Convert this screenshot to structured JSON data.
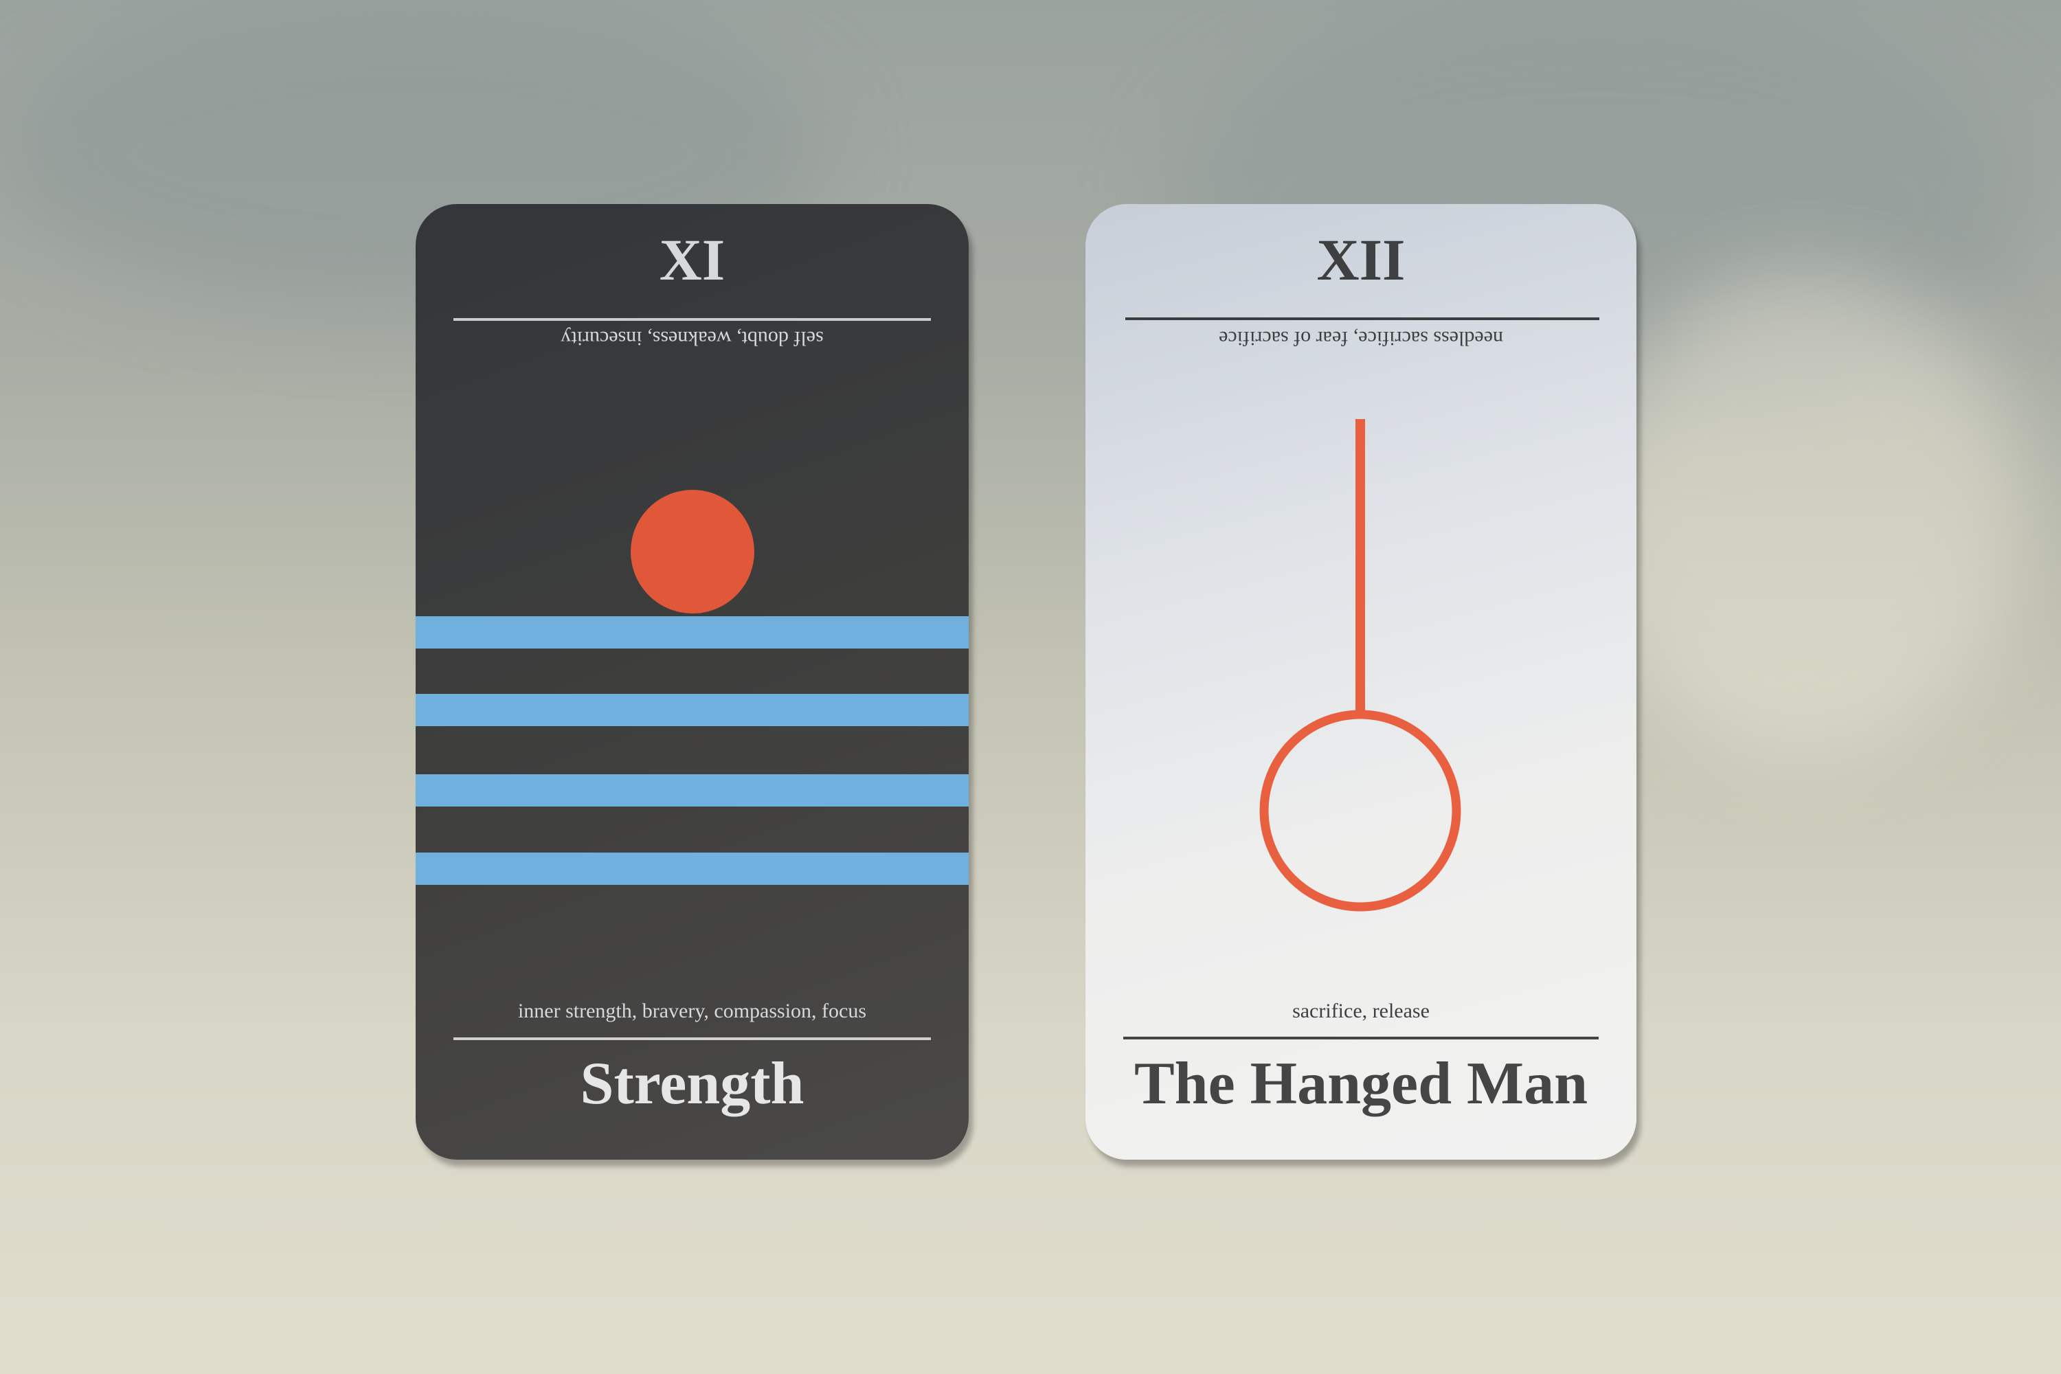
{
  "cards": [
    {
      "numeral": "XI",
      "reversed_meaning": "self doubt, weakness, insecurity",
      "upright_meaning": "inner strength, bravery, compassion, focus",
      "title": "Strength",
      "colors": {
        "sun": "#e0573a",
        "stripes": "#6fb0de"
      }
    },
    {
      "numeral": "XII",
      "reversed_meaning": "needless sacrifice, fear of sacrifice",
      "upright_meaning": "sacrifice, release",
      "title": "The Hanged Man",
      "colors": {
        "pendulum": "#e8603f"
      }
    }
  ]
}
